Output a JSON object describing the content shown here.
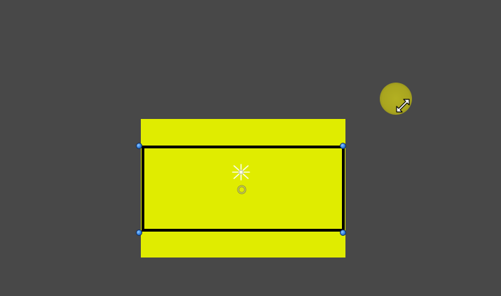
{
  "canvas": {
    "background_color": "#484848"
  },
  "shape": {
    "fill_color": "#e0ec00",
    "selection_border_color": "#000000",
    "handle_color": "#2f7fe0"
  },
  "icons": {
    "pivot": "pivot-cross-icon",
    "origin": "origin-ring-icon",
    "cursor": "diagonal-resize-cursor-icon"
  }
}
